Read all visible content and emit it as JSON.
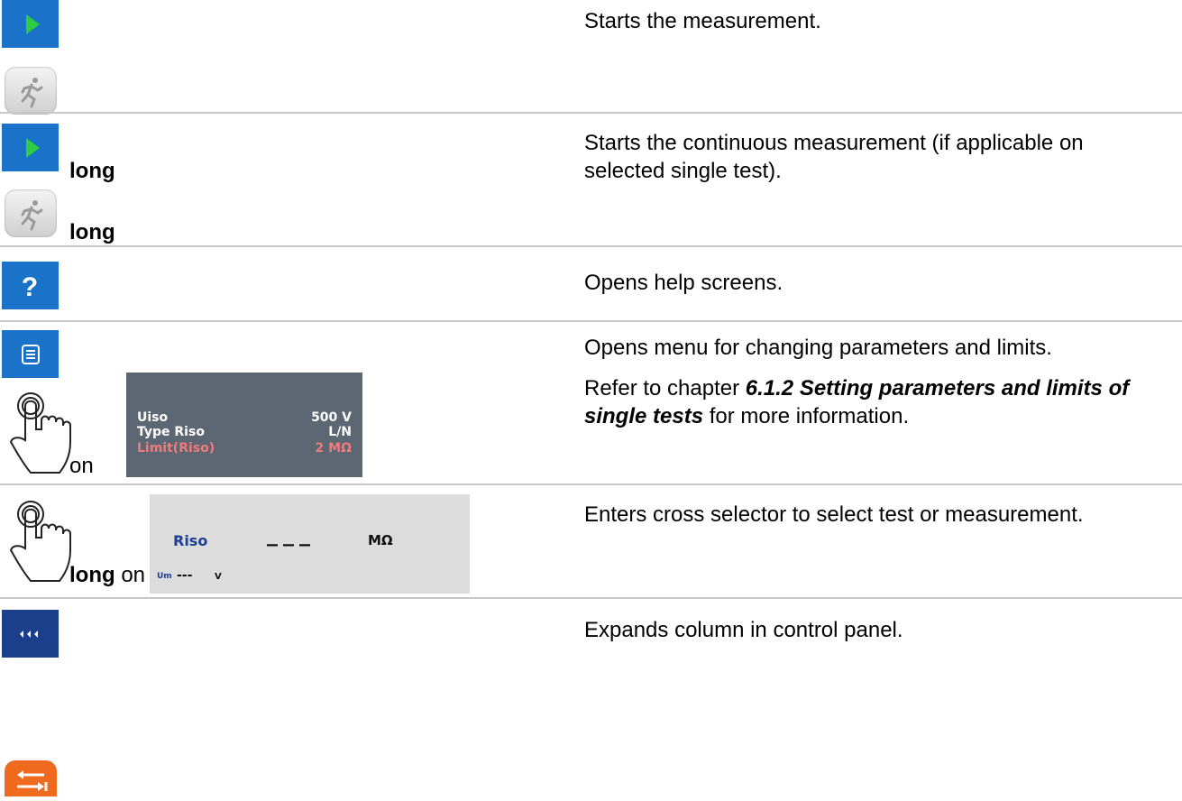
{
  "rows": [
    {
      "description": "Starts the measurement.",
      "icons": [
        "play-icon",
        "run-icon"
      ]
    },
    {
      "description": "Starts the continuous measurement (if applicable on selected single test).",
      "description_lines": [
        "Starts the continuous measurement (if applicable on",
        "selected single test)."
      ],
      "key_word": "long",
      "icons": [
        "play-icon",
        "run-icon"
      ]
    },
    {
      "description": "Opens help screens.",
      "icons": [
        "help-icon"
      ]
    },
    {
      "description": "Opens menu for changing parameters and limits.",
      "reference": {
        "prefix": "Refer to chapter ",
        "chapter": "6.1.2 Setting parameters and limits of",
        "chapter2": "single tests",
        "suffix": " for more information."
      },
      "on_word": "on",
      "icons": [
        "list-icon",
        "tap-icon"
      ]
    },
    {
      "description": "Enters cross selector to select test or measurement.",
      "key_word": "long",
      "on_word": "on",
      "icons": [
        "tap-icon"
      ]
    },
    {
      "description": "Expands column in control panel.",
      "icons": [
        "expand-icon",
        "swap-icon"
      ]
    }
  ],
  "param_panel": {
    "rows": [
      {
        "label": "Uiso",
        "value": "500 V",
        "color": "#ffffff"
      },
      {
        "label": "Type Riso",
        "value": "L/N",
        "color": "#ffffff"
      },
      {
        "label": "Limit(Riso)",
        "value": "2 MΩ",
        "color": "#f07b7b"
      }
    ]
  },
  "result_panel": {
    "label": "Riso",
    "value": "___",
    "unit": "MΩ",
    "sub_label": "Um",
    "sub_value": "---",
    "sub_unit": "V",
    "label_color": "#1c3f94"
  },
  "colors": {
    "play_green": "#2ecc40",
    "button_blue": "#1a73c9",
    "navy": "#1b3f8a",
    "orange": "#ef6a1f",
    "divider": "#c8c8c8"
  }
}
